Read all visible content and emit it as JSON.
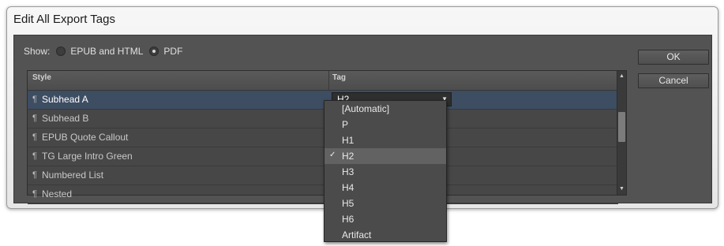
{
  "dialog": {
    "title": "Edit All Export Tags",
    "show_label": "Show:",
    "show_options": [
      {
        "label": "EPUB and HTML",
        "selected": false
      },
      {
        "label": "PDF",
        "selected": true
      }
    ]
  },
  "table": {
    "headers": {
      "style": "Style",
      "tag": "Tag"
    },
    "rows": [
      {
        "style": "Subhead A",
        "tag": "H2",
        "selected": true
      },
      {
        "style": "Subhead B",
        "tag": "",
        "selected": false
      },
      {
        "style": "EPUB Quote Callout",
        "tag": "",
        "selected": false
      },
      {
        "style": "TG Large Intro Green",
        "tag": "",
        "selected": false
      },
      {
        "style": "Numbered List",
        "tag": "",
        "selected": false
      },
      {
        "style": "Nested",
        "tag": "",
        "selected": false
      }
    ]
  },
  "tag_combo": {
    "value": "H2"
  },
  "dropdown": {
    "options": [
      "[Automatic]",
      "P",
      "H1",
      "H2",
      "H3",
      "H4",
      "H5",
      "H6",
      "Artifact"
    ],
    "checked": "H2"
  },
  "buttons": {
    "ok": "OK",
    "cancel": "Cancel"
  },
  "icons": {
    "pilcrow": "¶",
    "check": "✓",
    "down": "▼",
    "up": "▲"
  },
  "colors": {
    "panel": "#535353",
    "selected_row": "#3d4d62"
  }
}
